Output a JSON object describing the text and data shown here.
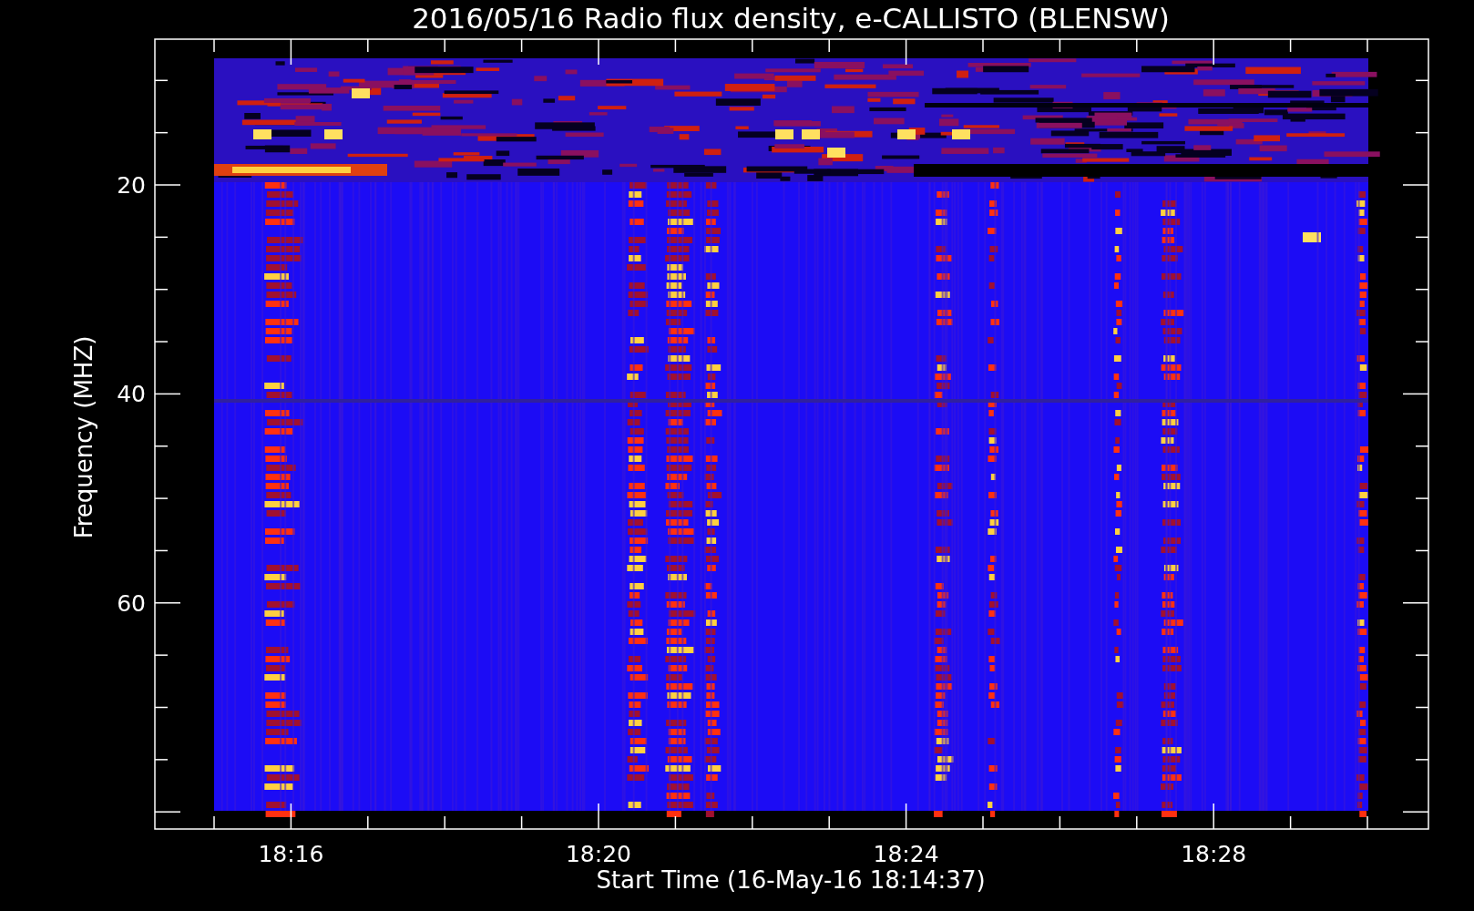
{
  "plot": {
    "title": "2016/05/16  Radio flux density, e-CALLISTO (BLENSW)",
    "ylabel": "Frequency (MHZ)",
    "xlabel": "Start Time (16-May-16 18:14:37)",
    "y_tick_labels": [
      "20",
      "40",
      "60"
    ],
    "x_tick_labels": [
      "18:16",
      "18:20",
      "18:24",
      "18:28"
    ]
  }
}
